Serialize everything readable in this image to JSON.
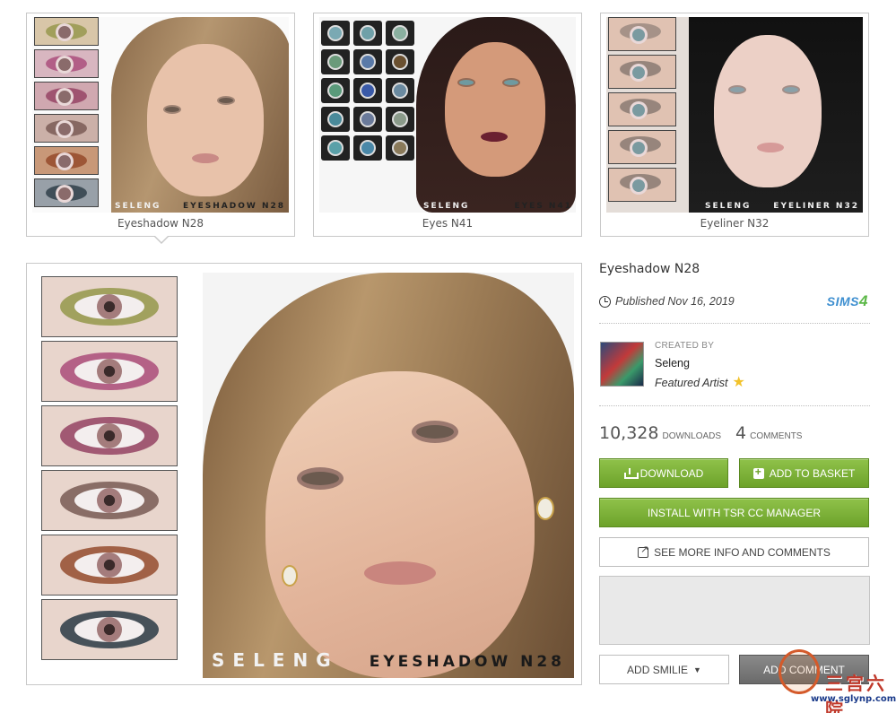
{
  "thumbnails": [
    {
      "caption": "Eyeshadow N28",
      "watermark_maker": "SELENG",
      "watermark_name": "EYESHADOW N28",
      "selected": true
    },
    {
      "caption": "Eyes N41",
      "watermark_maker": "SELENG",
      "watermark_name": "EYES N41",
      "selected": false
    },
    {
      "caption": "Eyeliner N32",
      "watermark_maker": "SELENG",
      "watermark_name": "EYELINER N32",
      "selected": false
    }
  ],
  "main_image": {
    "watermark_maker": "SELENG",
    "watermark_name": "EYESHADOW N28",
    "swatch_colors": [
      "#8a8f3a",
      "#a3396f",
      "#8a2f55",
      "#6a4a44",
      "#8a3a1a",
      "#2a3a44"
    ]
  },
  "eye_grid_colors": [
    "#7aa9b3",
    "#6fa0a8",
    "#8ab0a0",
    "#6a9a7a",
    "#5a7aa8",
    "#6a5030",
    "#5a9a7a",
    "#3a5aa8",
    "#6a8aa0",
    "#4a8a9a",
    "#6a7a9a",
    "#8a9a8a",
    "#5aa0a8",
    "#4a88a8",
    "#8a7a5a"
  ],
  "details": {
    "title": "Eyeshadow N28",
    "published": "Published Nov 16, 2019",
    "game_logo": {
      "text": "SIMS",
      "number": "4"
    },
    "created_by_label": "CREATED BY",
    "creator": "Seleng",
    "creator_badge": "Featured Artist",
    "downloads_count": "10,328",
    "downloads_label": "DOWNLOADS",
    "comments_count": "4",
    "comments_label": "COMMENTS"
  },
  "actions": {
    "download": "DOWNLOAD",
    "add_to_basket": "ADD TO BASKET",
    "install": "INSTALL WITH TSR CC MANAGER",
    "see_more": "SEE MORE INFO AND COMMENTS",
    "add_smilie": "ADD SMILIE",
    "add_comment": "ADD COMMENT"
  },
  "comment": {
    "value": ""
  },
  "site_watermark": {
    "text": "三宫六院",
    "url": "www.sglynp.com"
  },
  "colors": {
    "accent_green": "#7bb236",
    "button_dark": "#7a7a7a",
    "sims_blue": "#3e8fd0"
  }
}
